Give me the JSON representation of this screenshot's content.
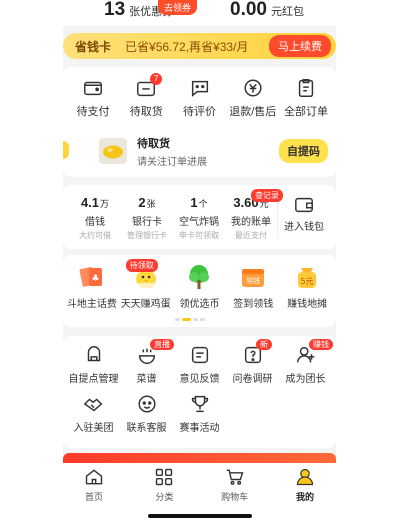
{
  "top": {
    "coupons": {
      "value": "13",
      "label": "张优惠券"
    },
    "coupon_badge": "去领券",
    "redpacket": {
      "value": "0.00",
      "label": "元红包"
    }
  },
  "save_card": {
    "title": "省钱卡",
    "saved": "已省¥56.72,再省¥33/月",
    "button": "马上续费"
  },
  "orders": {
    "items": [
      {
        "label": "待支付",
        "icon": "wallet-icon"
      },
      {
        "label": "待取货",
        "icon": "package-icon",
        "badge": "7"
      },
      {
        "label": "待评价",
        "icon": "comment-icon"
      },
      {
        "label": "退款/售后",
        "icon": "refund-icon"
      },
      {
        "label": "全部订单",
        "icon": "list-icon"
      }
    ],
    "pickup": {
      "title": "待取货",
      "subtitle": "请关注订单进展",
      "button": "自提码"
    }
  },
  "wallet": {
    "items": [
      {
        "value": "4.1",
        "unit": "万",
        "label": "借钱",
        "sub": "大约可借"
      },
      {
        "value": "2",
        "unit": "张",
        "label": "银行卡",
        "sub": "管理银行卡"
      },
      {
        "value": "1",
        "unit": "个",
        "label": "空气炸锅",
        "sub": "申卡可领取"
      },
      {
        "value": "3.60",
        "unit": "元",
        "label": "我的账单",
        "sub": "最近支付",
        "badge": "查记录"
      }
    ],
    "enter_label": "进入钱包"
  },
  "fun": {
    "items": [
      {
        "label": "斗地主话费",
        "icon": "cards-icon"
      },
      {
        "label": "天天赚鸡蛋",
        "icon": "chick-icon",
        "badge": "待领取"
      },
      {
        "label": "领优选币",
        "icon": "tree-icon"
      },
      {
        "label": "签到领钱",
        "icon": "signin-icon"
      },
      {
        "label": "赚钱地摊",
        "icon": "coin-bag-icon"
      }
    ]
  },
  "tools": {
    "row1": [
      {
        "label": "自提点管理",
        "icon": "shop-icon"
      },
      {
        "label": "菜谱",
        "icon": "recipe-icon",
        "badge": "直播"
      },
      {
        "label": "意见反馈",
        "icon": "feedback-icon"
      },
      {
        "label": "问卷调研",
        "icon": "survey-icon",
        "badge": "新"
      },
      {
        "label": "成为团长",
        "icon": "leader-icon",
        "badge": "赚钱"
      }
    ],
    "row2": [
      {
        "label": "入驻美团",
        "icon": "handshake-icon"
      },
      {
        "label": "联系客服",
        "icon": "service-icon"
      },
      {
        "label": "赛事活动",
        "icon": "trophy-icon"
      }
    ]
  },
  "tabbar": [
    {
      "label": "首页",
      "icon": "home-icon"
    },
    {
      "label": "分类",
      "icon": "category-icon"
    },
    {
      "label": "购物车",
      "icon": "cart-icon"
    },
    {
      "label": "我的",
      "icon": "profile-icon",
      "active": true
    }
  ],
  "colors": {
    "accent": "#ffd43b",
    "red": "#ff3b30",
    "orange": "#ff4a2b"
  }
}
